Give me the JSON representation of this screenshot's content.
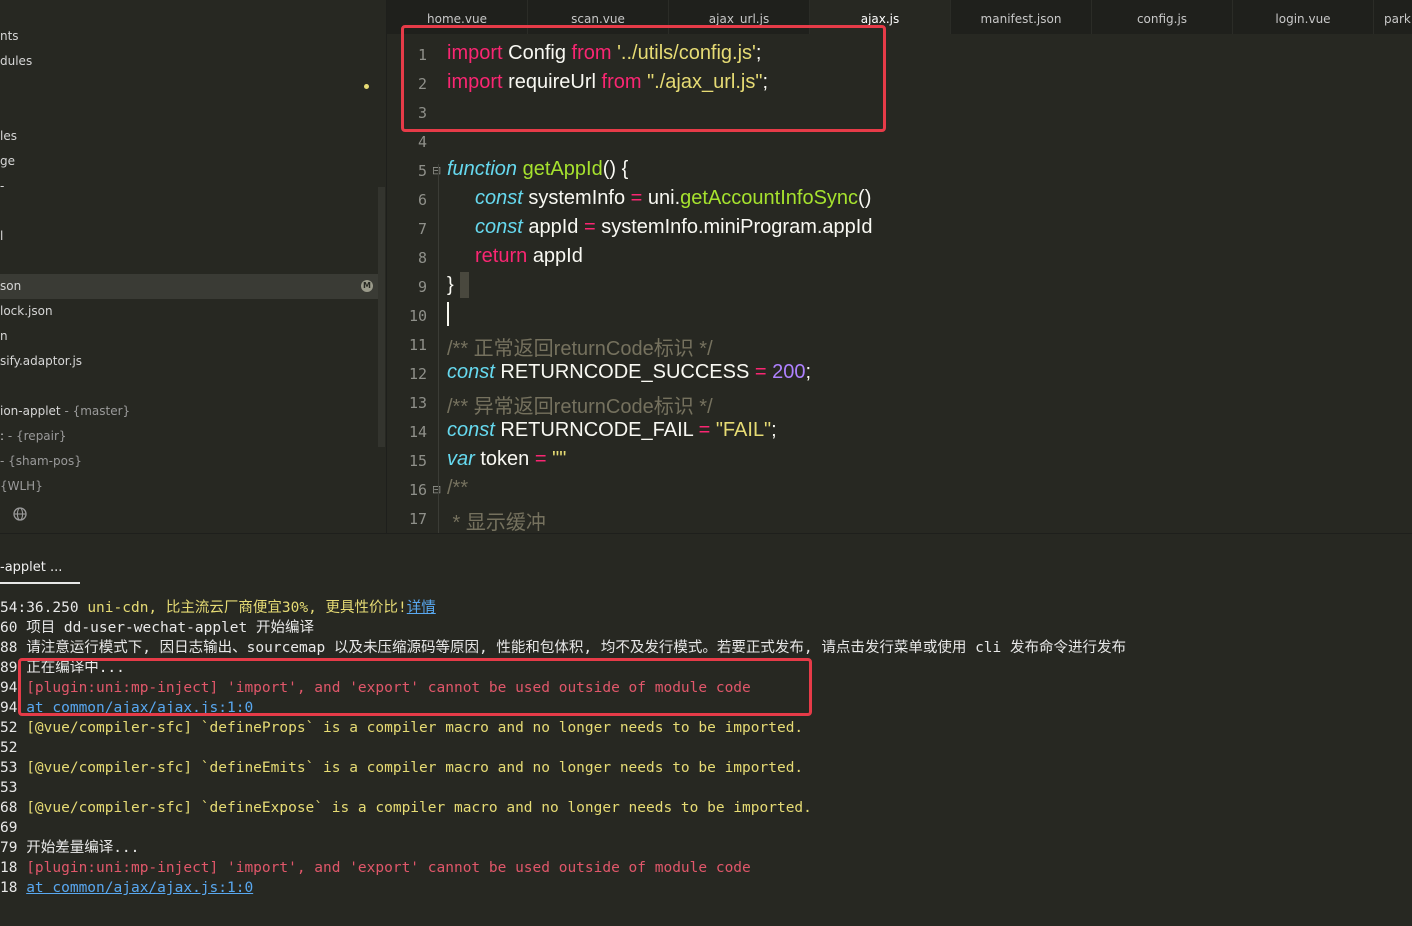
{
  "sidebar": {
    "items": [
      {
        "label": "nts"
      },
      {
        "label": "dules"
      },
      {
        "label": "les"
      },
      {
        "label": "ge"
      },
      {
        "label": "-"
      },
      {
        "label": "l"
      },
      {
        "label": "son"
      },
      {
        "label": "lock.json"
      },
      {
        "label": "n"
      },
      {
        "label": "sify.adaptor.js"
      }
    ],
    "modified_badge": "M",
    "projects": [
      {
        "name": "ion-applet",
        "branch": " - {master}"
      },
      {
        "name": ": ",
        "branch": "- {repair}"
      },
      {
        "name": " ",
        "branch": "- {sham-pos}"
      },
      {
        "name": "",
        "branch": "{WLH}"
      }
    ]
  },
  "tabs": [
    {
      "label": "home.vue"
    },
    {
      "label": "scan.vue"
    },
    {
      "label": "ajax_url.js"
    },
    {
      "label": "ajax.js"
    },
    {
      "label": "manifest.json"
    },
    {
      "label": "config.js"
    },
    {
      "label": "login.vue"
    },
    {
      "label": "park"
    }
  ],
  "editor": {
    "line_numbers": [
      "1",
      "2",
      "3",
      "4",
      "5",
      "6",
      "7",
      "8",
      "9",
      "10",
      "11",
      "12",
      "13",
      "14",
      "15",
      "16",
      "17"
    ],
    "tokens": {
      "import": "import",
      "from": "from",
      "l1_name": "Config",
      "l1_str": "'../utils/config.js'",
      "semi": ";",
      "l2_name": "requireUrl",
      "l2_str": "\"./ajax_url.js\"",
      "function": "function",
      "getAppId": "getAppId",
      "paren_brace": "() {",
      "const": "const",
      "systemInfo": "systemInfo",
      "eq": "=",
      "uni_dot": "uni.",
      "getAccountInfoSync": "getAccountInfoSync",
      "parens": "()",
      "appId": "appId",
      "appId_expr": "systemInfo.miniProgram.appId",
      "return": "return",
      "close_brace": "}",
      "comment1": "/** 正常返回returnCode标识 */",
      "success_name": "RETURNCODE_SUCCESS",
      "success_val": "200",
      "comment2": "/** 异常返回returnCode标识 */",
      "fail_name": "RETURNCODE_FAIL",
      "fail_val": "\"FAIL\"",
      "var": "var",
      "token": "token",
      "empty_str": "\"\"",
      "comment3": "/**",
      "comment4": " * 显示缓冲"
    }
  },
  "console": {
    "tab_label": "-applet ...",
    "lines": [
      {
        "prefix": "54:36.250 ",
        "text": "uni-cdn, 比主流云厂商便宜30%, 更具性价比!",
        "link": "详情",
        "color": "yellow"
      },
      {
        "prefix": "60 ",
        "text": "项目 dd-user-wechat-applet 开始编译",
        "color": "white"
      },
      {
        "prefix": "88 ",
        "text": "请注意运行模式下, 因日志输出、sourcemap 以及未压缩源码等原因, 性能和包体积, 均不及发行模式。若要正式发布, 请点击发行菜单或使用 cli 发布命令进行发布",
        "color": "white"
      },
      {
        "prefix": "89 ",
        "text": "正在编译中...",
        "color": "white"
      },
      {
        "prefix": "94 ",
        "text": "[plugin:uni:mp-inject] 'import', and 'export' cannot be used outside of module code",
        "color": "red"
      },
      {
        "prefix": "94 ",
        "link": "at common/ajax/ajax.js:1:0",
        "color": "link"
      },
      {
        "prefix": "52 ",
        "text": "[@vue/compiler-sfc] `defineProps` is a compiler macro and no longer needs to be imported.",
        "color": "yellow"
      },
      {
        "prefix": "52",
        "text": "",
        "color": "white"
      },
      {
        "prefix": "53 ",
        "text": "[@vue/compiler-sfc] `defineEmits` is a compiler macro and no longer needs to be imported.",
        "color": "yellow"
      },
      {
        "prefix": "53",
        "text": "",
        "color": "white"
      },
      {
        "prefix": "68 ",
        "text": "[@vue/compiler-sfc] `defineExpose` is a compiler macro and no longer needs to be imported.",
        "color": "yellow"
      },
      {
        "prefix": "69",
        "text": "",
        "color": "white"
      },
      {
        "prefix": "79 ",
        "text": "开始差量编译...",
        "color": "white"
      },
      {
        "prefix": "18 ",
        "text": "[plugin:uni:mp-inject] 'import', and 'export' cannot be used outside of module code",
        "color": "red"
      },
      {
        "prefix": "18 ",
        "link": "at common/ajax/ajax.js:1:0",
        "color": "link"
      }
    ]
  },
  "colors": {
    "background": "#272822",
    "keyword": "#f92672",
    "string": "#e6db74",
    "function": "#a6e22e",
    "storage": "#66d9ef",
    "number": "#ae81ff",
    "comment": "#75715e",
    "highlight_box": "#e63b48",
    "error_text": "#e0576a",
    "link": "#59a8f0"
  }
}
